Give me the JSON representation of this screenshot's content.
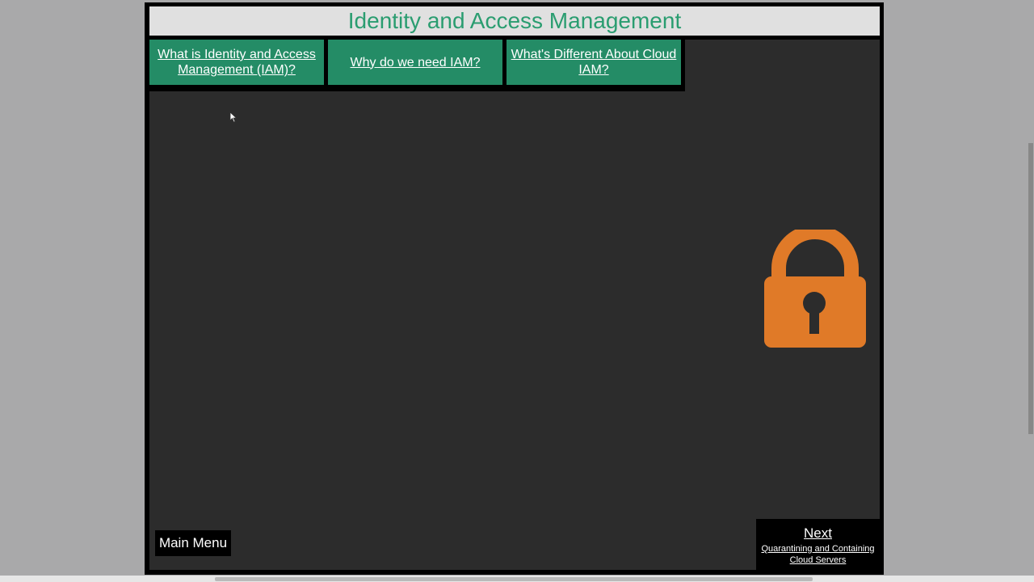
{
  "page": {
    "title": "Identity and Access Management"
  },
  "tabs": [
    {
      "label": "What is Identity and Access Management (IAM)?"
    },
    {
      "label": "Why do we need IAM?"
    },
    {
      "label": "What's Different About Cloud IAM?"
    }
  ],
  "nav": {
    "main_menu_label": "Main Menu",
    "next_label": "Next",
    "next_subtitle": "Quarantining and Containing Cloud Servers"
  },
  "illustration": {
    "icon": "padlock-icon",
    "color": "#e07a28"
  },
  "colors": {
    "accent": "#2a9d70",
    "tab_background": "#248c66",
    "content_background": "#2c2c2c",
    "page_background": "#a9a9aa"
  }
}
